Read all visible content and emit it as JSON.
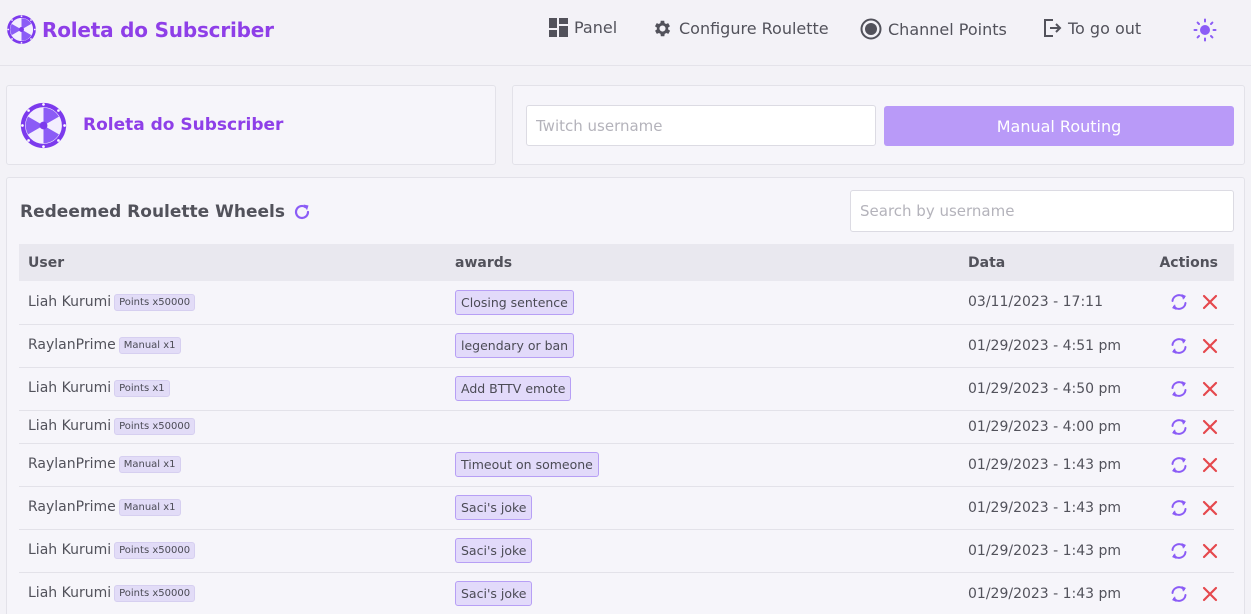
{
  "navbar": {
    "brand": "Roleta do Subscriber",
    "items": [
      {
        "label": "Panel",
        "icon": "panel-icon"
      },
      {
        "label": "Configure Roulette",
        "icon": "gear-icon"
      },
      {
        "label": "Channel Points",
        "icon": "channel-points-icon"
      },
      {
        "label": "To go out",
        "icon": "logout-icon"
      }
    ],
    "theme": {
      "light_icon": "sun-icon",
      "dark_icon": "moon-icon"
    }
  },
  "brand_card": {
    "title": "Roleta do Subscriber"
  },
  "manual": {
    "username_placeholder": "Twitch username",
    "button_label": "Manual Routing"
  },
  "redeemed": {
    "title": "Redeemed Roulette Wheels",
    "search_placeholder": "Search by username",
    "columns": [
      "User",
      "awards",
      "Data",
      "Actions"
    ],
    "rows": [
      {
        "user": "Liah Kurumi",
        "badge": "Points x50000",
        "award": "Closing sentence",
        "date": "03/11/2023 - 17:11"
      },
      {
        "user": "RaylanPrime",
        "badge": "Manual x1",
        "award": "legendary or ban",
        "date": "01/29/2023 - 4:51 pm"
      },
      {
        "user": "Liah Kurumi",
        "badge": "Points x1",
        "award": "Add BTTV emote",
        "date": "01/29/2023 - 4:50 pm"
      },
      {
        "user": "Liah Kurumi",
        "badge": "Points x50000",
        "award": "",
        "date": "01/29/2023 - 4:00 pm"
      },
      {
        "user": "RaylanPrime",
        "badge": "Manual x1",
        "award": "Timeout on someone",
        "date": "01/29/2023 - 1:43 pm"
      },
      {
        "user": "RaylanPrime",
        "badge": "Manual x1",
        "award": "Saci's joke",
        "date": "01/29/2023 - 1:43 pm"
      },
      {
        "user": "Liah Kurumi",
        "badge": "Points x50000",
        "award": "Saci's joke",
        "date": "01/29/2023 - 1:43 pm"
      },
      {
        "user": "Liah Kurumi",
        "badge": "Points x50000",
        "award": "Saci's joke",
        "date": "01/29/2023 - 1:43 pm"
      }
    ]
  },
  "colors": {
    "accent": "#8e3fe8",
    "button": "#b99af8",
    "delete": "#e5484d",
    "reroll": "#8b5cf6"
  }
}
